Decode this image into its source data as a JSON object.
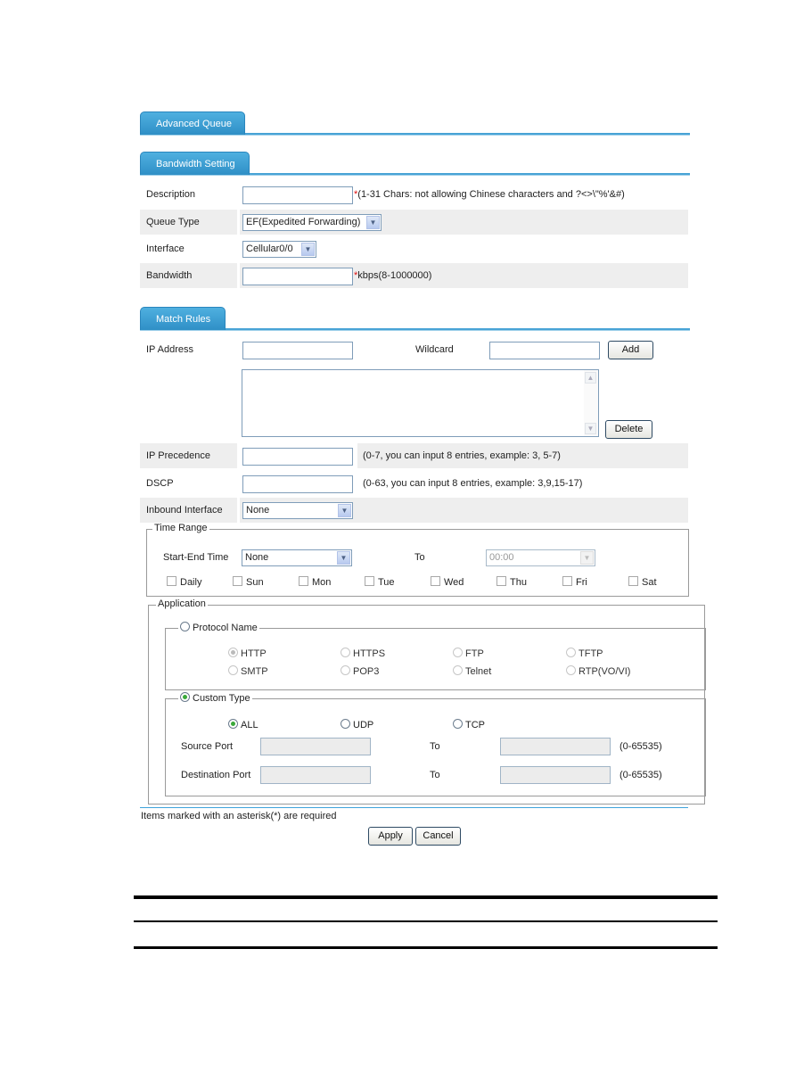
{
  "sections": {
    "advanced_queue": "Advanced Queue",
    "bandwidth_setting": "Bandwidth Setting",
    "match_rules": "Match Rules"
  },
  "bandwidth": {
    "description": {
      "label": "Description",
      "value": "",
      "required_mark": "*",
      "hint": "(1-31 Chars: not allowing Chinese characters and ?<>\\\"%'&#)"
    },
    "queue_type": {
      "label": "Queue Type",
      "selected": "EF(Expedited Forwarding)"
    },
    "interface": {
      "label": "Interface",
      "selected": "Cellular0/0"
    },
    "bandwidth": {
      "label": "Bandwidth",
      "value": "",
      "required_mark": "*",
      "hint": "kbps(8-1000000)"
    }
  },
  "match": {
    "ip_address": {
      "label": "IP Address",
      "value": ""
    },
    "wildcard": {
      "label": "Wildcard",
      "value": ""
    },
    "add_button": "Add",
    "delete_button": "Delete",
    "ip_precedence": {
      "label": "IP Precedence",
      "value": "",
      "hint": "(0-7, you can input 8 entries, example: 3, 5-7)"
    },
    "dscp": {
      "label": "DSCP",
      "value": "",
      "hint": "(0-63, you can input 8 entries, example: 3,9,15-17)"
    },
    "inbound_interface": {
      "label": "Inbound Interface",
      "selected": "None"
    }
  },
  "time_range": {
    "legend": "Time Range",
    "start_end_label": "Start-End Time",
    "start_selected": "None",
    "to_label": "To",
    "end_selected": "00:00",
    "days": [
      "Daily",
      "Sun",
      "Mon",
      "Tue",
      "Wed",
      "Thu",
      "Fri",
      "Sat"
    ]
  },
  "application": {
    "legend": "Application",
    "protocol_name": {
      "legend": "Protocol Name",
      "selected": false,
      "options": [
        "HTTP",
        "HTTPS",
        "FTP",
        "TFTP",
        "SMTP",
        "POP3",
        "Telnet",
        "RTP(VO/VI)"
      ],
      "checked_option": "HTTP"
    },
    "custom_type": {
      "legend": "Custom Type",
      "selected": true,
      "protocols": [
        "ALL",
        "UDP",
        "TCP"
      ],
      "checked_protocol": "ALL",
      "source_port_label": "Source Port",
      "destination_port_label": "Destination Port",
      "to_label": "To",
      "range_hint": "(0-65535)",
      "source_from": "",
      "source_to": "",
      "dest_from": "",
      "dest_to": ""
    }
  },
  "footer": {
    "required_note": "Items marked with an asterisk(*) are required",
    "apply_button": "Apply",
    "cancel_button": "Cancel"
  }
}
